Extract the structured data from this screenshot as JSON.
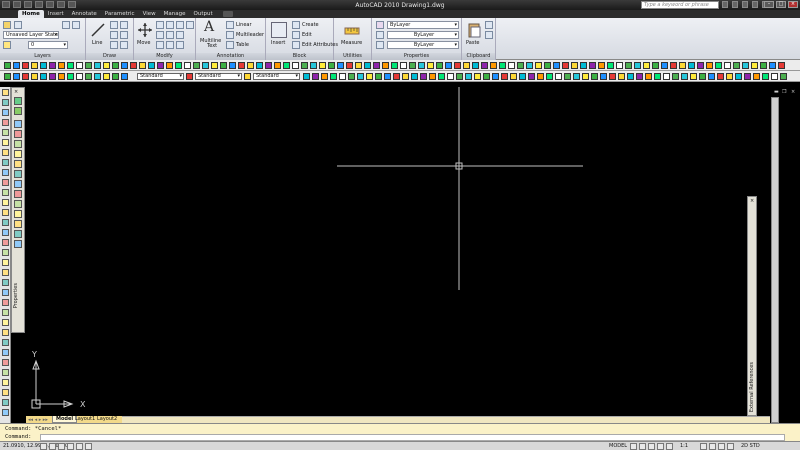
{
  "titlebar": {
    "app_title": "AutoCAD 2010    Drawing1.dwg",
    "search_placeholder": "Type a keyword or phrase"
  },
  "tabs": [
    "Home",
    "Insert",
    "Annotate",
    "Parametric",
    "View",
    "Manage",
    "Output"
  ],
  "ribbon": {
    "layers": {
      "title": "Layers",
      "layer_state": "Unsaved Layer State",
      "current_layer": "0"
    },
    "draw": {
      "title": "Draw",
      "line_label": "Line"
    },
    "modify": {
      "title": "Modify",
      "move_label": "Move"
    },
    "annotation": {
      "title": "Annotation",
      "multiline_text": "Multiline",
      "multiline_text_2": "Text",
      "linear": "Linear",
      "multileader": "Multileader",
      "table": "Table"
    },
    "block": {
      "title": "Block",
      "insert": "Insert",
      "create": "Create",
      "edit": "Edit",
      "edit_attributes": "Edit Attributes"
    },
    "utilities": {
      "title": "Utilities",
      "measure": "Measure"
    },
    "properties": {
      "title": "Properties",
      "color": "ByLayer",
      "linetype": "ByLayer",
      "lineweight": "ByLayer"
    },
    "clipboard": {
      "title": "Clipboard",
      "paste": "Paste"
    }
  },
  "toolbar": {
    "style_combo_1": "Standard",
    "style_combo_2": "Standard",
    "style_combo_3": "Standard"
  },
  "palettes": {
    "properties_title": "Properties",
    "xref_title": "External References"
  },
  "ucs": {
    "x_label": "X",
    "y_label": "Y"
  },
  "layout_tabs": [
    "Model",
    "Layout1",
    "Layout2"
  ],
  "command": {
    "line1": "Command: *Cancel*",
    "line2": "Command:"
  },
  "status": {
    "coords": "21.0910, 12.9946, 0.0000",
    "model": "MODEL",
    "scale": "1:1",
    "workspace": "2D STD"
  },
  "colors": {
    "drawing_bg": "#000000",
    "crosshair": "#bfbfbf",
    "command_bg": "#fbf2c8",
    "layout_tab_bar": "#f2d98a"
  }
}
